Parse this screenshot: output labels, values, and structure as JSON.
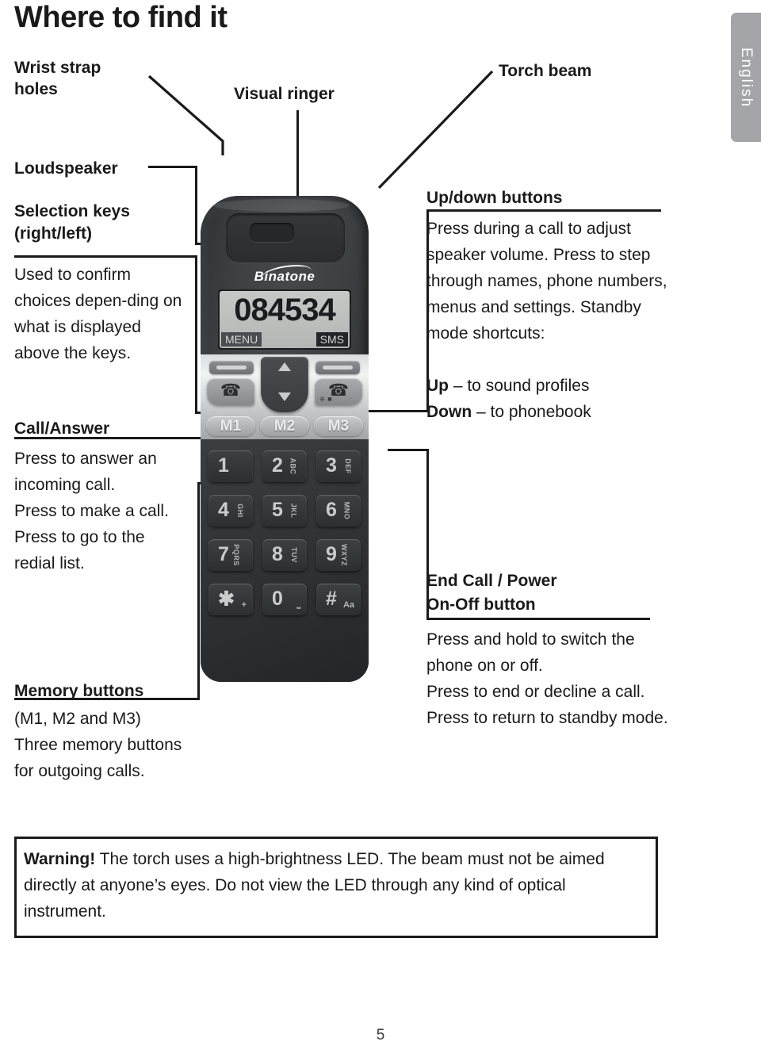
{
  "page": {
    "title": "Where to find it",
    "number": "5",
    "language_tab": "English"
  },
  "callouts": {
    "wrist_strap": "Wrist strap\nholes",
    "visual_ringer": "Visual ringer",
    "torch_beam": "Torch beam",
    "loudspeaker": "Loudspeaker",
    "selection_keys_title": "Selection keys\n(right/left)",
    "selection_keys_body": "Used to confirm choices depen-ding on what is displayed above the keys.",
    "call_answer_title": "Call/Answer",
    "call_answer_body": "Press to answer an incoming call.\nPress to make a call.\nPress to go to the redial list.",
    "memory_buttons_title": "Memory buttons",
    "memory_buttons_body": "(M1, M2 and M3)\nThree memory buttons\nfor outgoing calls.",
    "updown_title": "Up/down buttons",
    "updown_body_1": "Press during a call to adjust speaker volume. Press to step through names, phone numbers, menus and settings. Standby mode shortcuts:",
    "updown_up_bold": "Up",
    "updown_up_rest": " – to sound profiles",
    "updown_down_bold": "Down",
    "updown_down_rest": " – to phonebook",
    "endcall_title": "End Call / Power\nOn-Off button",
    "endcall_body": "Press and hold to switch the phone on or off.\nPress to end or decline a call.\nPress to return to standby mode."
  },
  "warning": {
    "lead": "Warning!",
    "text": " The torch uses a high-brightness LED. The beam must not be aimed directly at anyone’s eyes. Do not view the LED through any kind of optical instrument."
  },
  "phone": {
    "brand": "Binatone",
    "screen_number": "084534",
    "softkey_left": "MENU",
    "softkey_right": "SMS",
    "memory_keys": [
      "M1",
      "M2",
      "M3"
    ],
    "keypad": [
      {
        "digit": "1",
        "letters": ""
      },
      {
        "digit": "2",
        "letters": "ABC"
      },
      {
        "digit": "3",
        "letters": "DEF"
      },
      {
        "digit": "4",
        "letters": "GHI"
      },
      {
        "digit": "5",
        "letters": "JKL"
      },
      {
        "digit": "6",
        "letters": "MNO"
      },
      {
        "digit": "7",
        "letters": "PQRS"
      },
      {
        "digit": "8",
        "letters": "TUV"
      },
      {
        "digit": "9",
        "letters": "WXYZ"
      },
      {
        "digit": "✱",
        "letters": "+"
      },
      {
        "digit": "0",
        "letters": "␣"
      },
      {
        "digit": "#",
        "letters": "Aa"
      }
    ]
  },
  "colors": {
    "ink": "#1a1a1a",
    "tab_grey": "#a3a5a8",
    "phone_dark": "#36393c",
    "screen_grey": "#c6c8c6"
  }
}
